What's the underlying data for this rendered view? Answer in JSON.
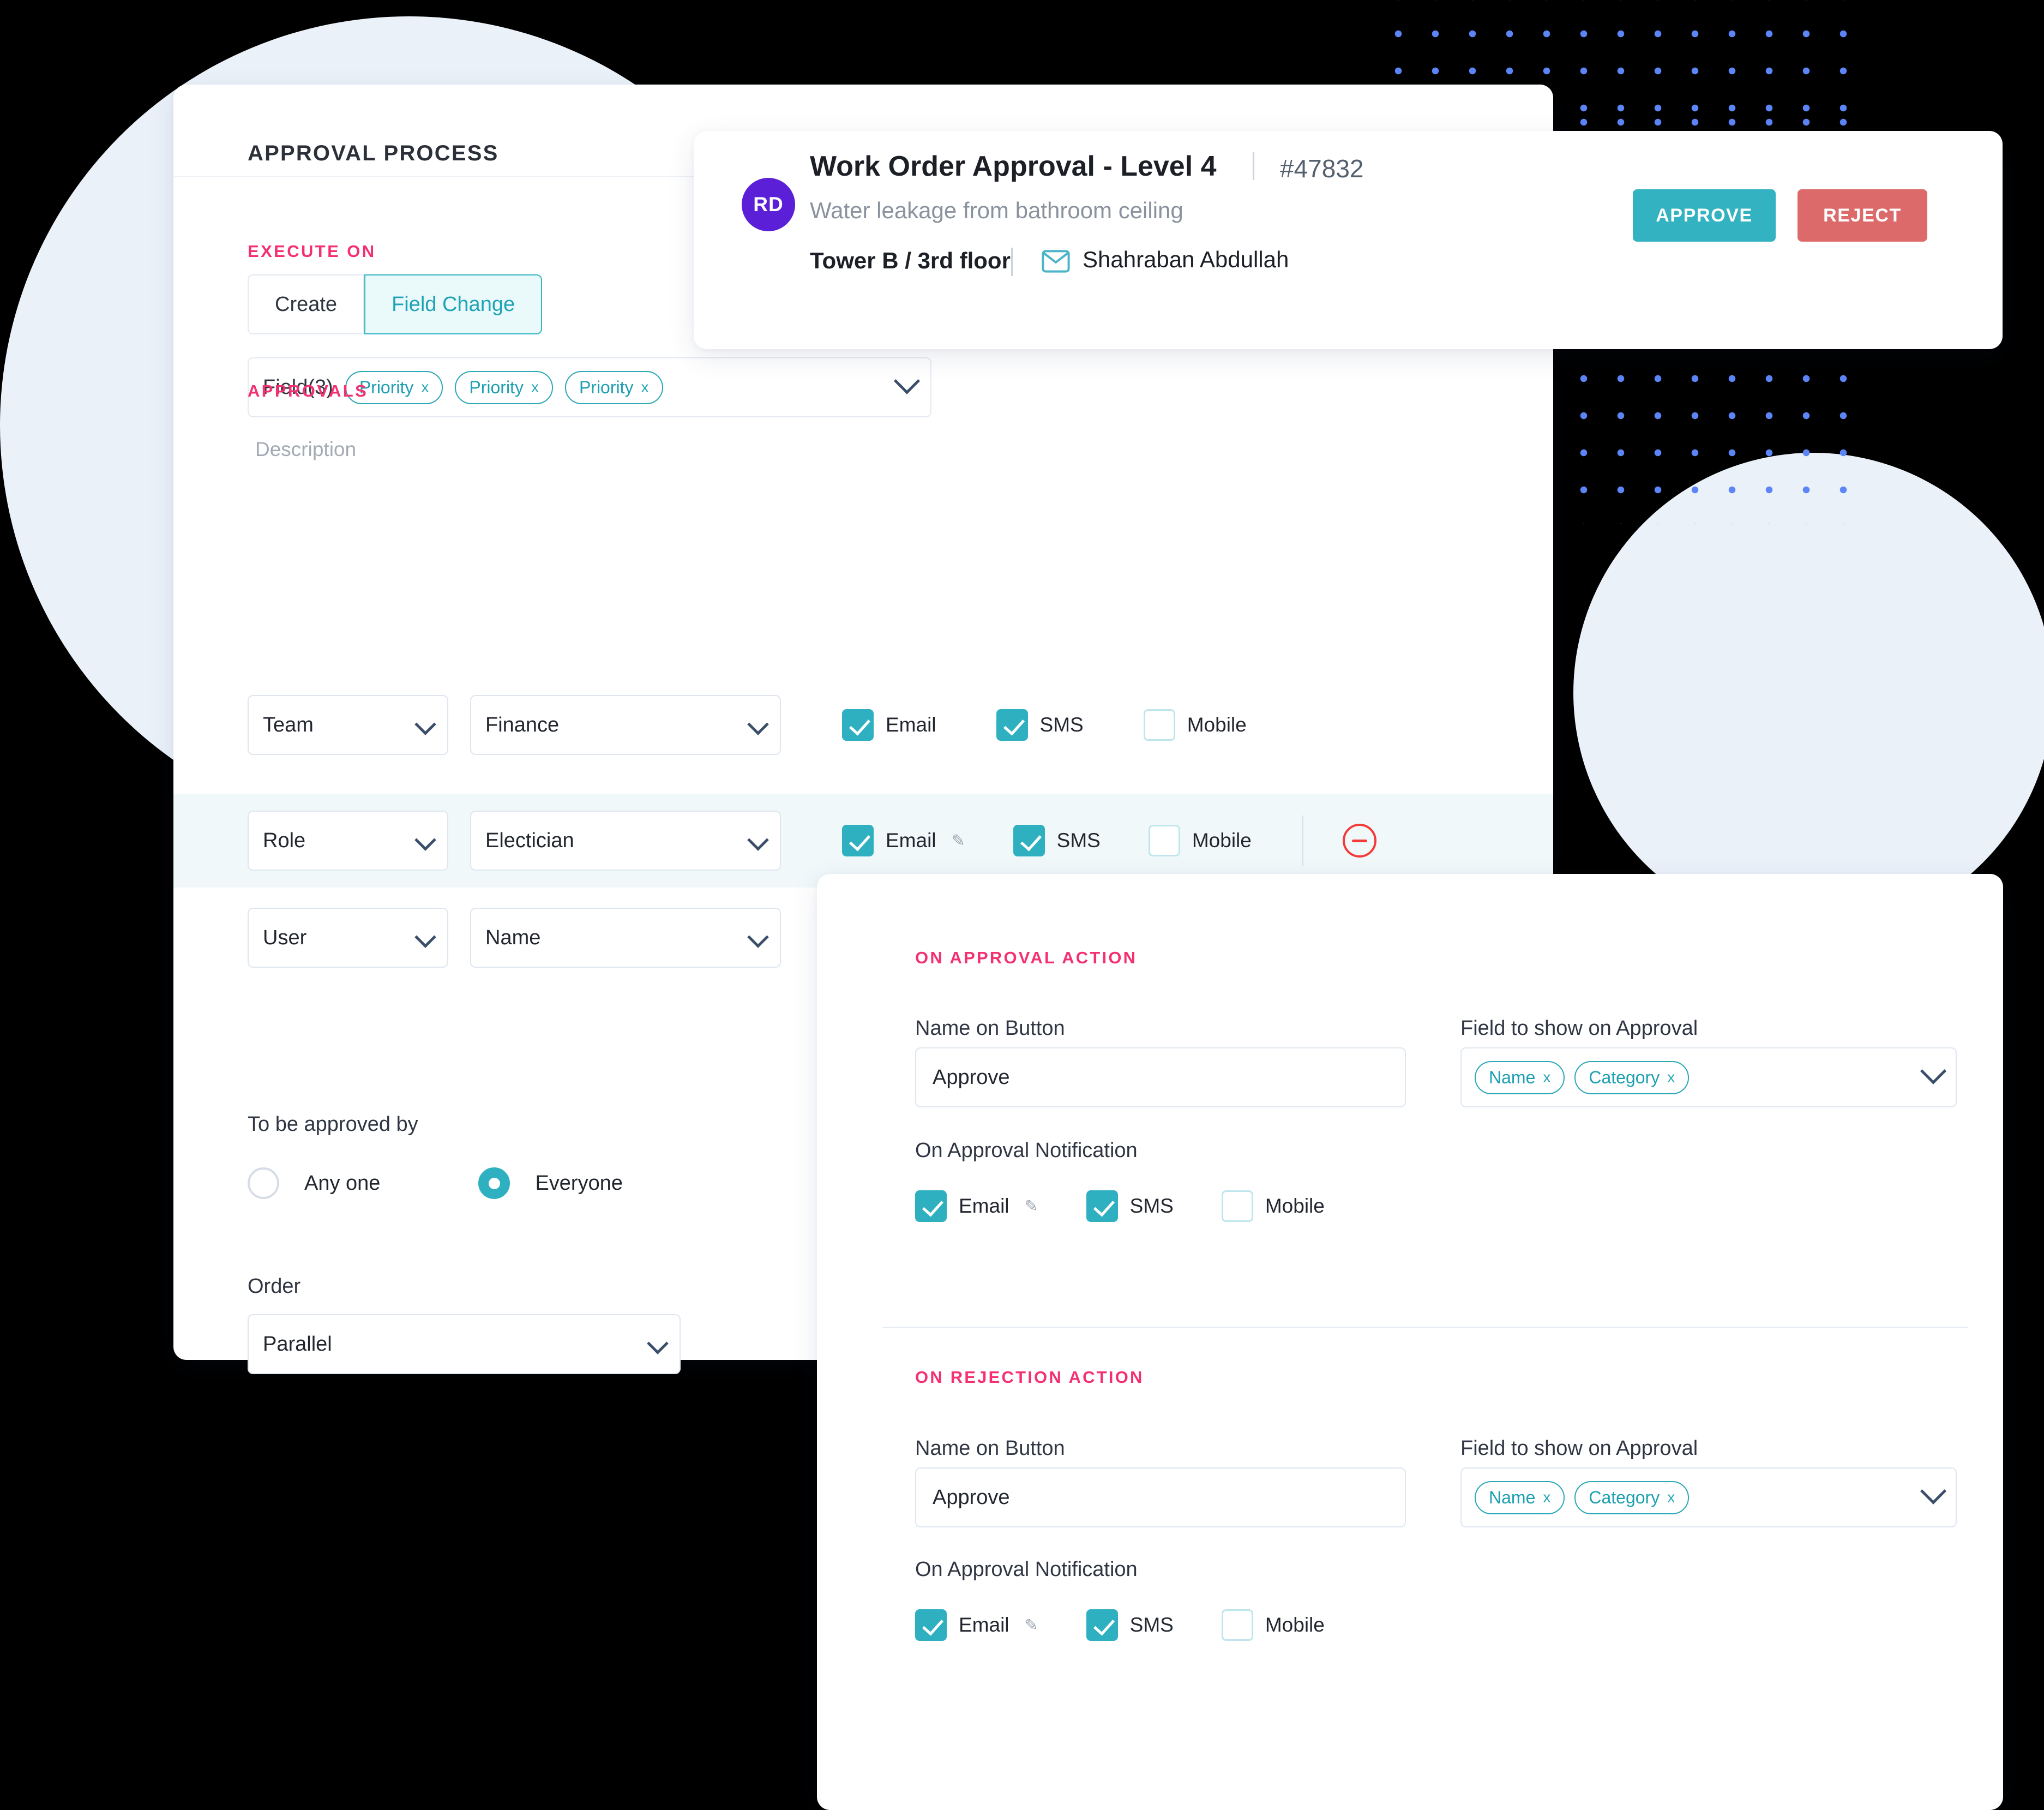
{
  "background": {
    "accent_dot_color": "#5C85F7",
    "circle_color": "#EBF1F9"
  },
  "left_panel": {
    "header_title": "APPROVAL PROCESS",
    "execute_on": {
      "label": "EXECUTE ON",
      "tabs": [
        {
          "label": "Create",
          "active": false
        },
        {
          "label": "Field Change",
          "active": true
        }
      ],
      "field_selector": {
        "label": "Field(3)",
        "chips": [
          {
            "label": "Priority",
            "remove": "x"
          },
          {
            "label": "Priority",
            "remove": "x"
          },
          {
            "label": "Priority",
            "remove": "x"
          }
        ]
      },
      "description_placeholder": "Description"
    },
    "approvals": {
      "label": "APPROVALS",
      "rows": [
        {
          "type_value": "Team",
          "target_value": "Finance",
          "notifications": [
            {
              "label": "Email",
              "checked": true,
              "has_edit": false
            },
            {
              "label": "SMS",
              "checked": true,
              "has_edit": false
            },
            {
              "label": "Mobile",
              "checked": false,
              "has_edit": false
            }
          ],
          "highlighted": false,
          "removable": false
        },
        {
          "type_value": "Role",
          "target_value": "Electician",
          "notifications": [
            {
              "label": "Email",
              "checked": true,
              "has_edit": true
            },
            {
              "label": "SMS",
              "checked": true,
              "has_edit": false
            },
            {
              "label": "Mobile",
              "checked": false,
              "has_edit": false
            }
          ],
          "highlighted": true,
          "removable": true
        },
        {
          "type_value": "User",
          "target_value": "Name",
          "notifications": [],
          "highlighted": false,
          "removable": false
        }
      ]
    },
    "approved_by": {
      "label": "To be approved by",
      "options": [
        {
          "label": "Any one",
          "selected": false
        },
        {
          "label": "Everyone",
          "selected": true
        }
      ]
    },
    "order": {
      "label": "Order",
      "value": "Parallel"
    }
  },
  "work_order_card": {
    "avatar_initials": "RD",
    "avatar_color": "#5A1FD6",
    "title": "Work Order Approval - Level 4",
    "separator": "|",
    "ticket_id": "#47832",
    "subtitle": "Water leakage from bathroom ceiling",
    "location": "Tower B / 3rd floor",
    "assignee": "Shahraban Abdullah",
    "approve_button": "APPROVE",
    "reject_button": "REJECT",
    "approve_color": "#33B2C2",
    "reject_color": "#DD6A6A"
  },
  "action_panel": {
    "sections": [
      {
        "label": "ON APPROVAL ACTION",
        "button_name_label": "Name on Button",
        "button_name_value": "Approve",
        "field_show_label": "Field to show on Approval",
        "field_chips": [
          {
            "label": "Name",
            "remove": "x"
          },
          {
            "label": "Category",
            "remove": "x"
          }
        ],
        "notification_label": "On Approval Notification",
        "notifications": [
          {
            "label": "Email",
            "checked": true,
            "has_edit": true
          },
          {
            "label": "SMS",
            "checked": true,
            "has_edit": false
          },
          {
            "label": "Mobile",
            "checked": false,
            "has_edit": false
          }
        ]
      },
      {
        "label": "ON REJECTION ACTION",
        "button_name_label": "Name on Button",
        "button_name_value": "Approve",
        "field_show_label": "Field to show on Approval",
        "field_chips": [
          {
            "label": "Name",
            "remove": "x"
          },
          {
            "label": "Category",
            "remove": "x"
          }
        ],
        "notification_label": "On Approval Notification",
        "notifications": [
          {
            "label": "Email",
            "checked": true,
            "has_edit": true
          },
          {
            "label": "SMS",
            "checked": true,
            "has_edit": false
          },
          {
            "label": "Mobile",
            "checked": false,
            "has_edit": false
          }
        ]
      }
    ]
  }
}
